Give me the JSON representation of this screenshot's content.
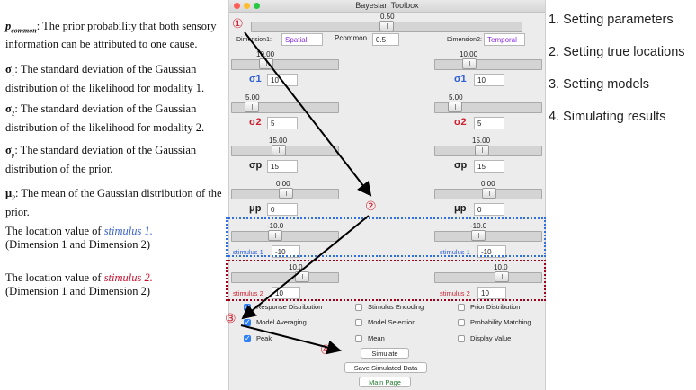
{
  "annotations": {
    "pcommon_sym": "p",
    "pcommon_sub": "common",
    "pcommon_text": ": The prior probability that both sensory information can be attributed to one cause.",
    "s1_sym": "σ",
    "s1_sub": "1",
    "s1_text": ": The standard deviation of the Gaussian distribution of the likelihood for modality 1.",
    "s2_sym": "σ",
    "s2_sub": "2",
    "s2_text": ": The standard deviation of the Gaussian distribution of the likelihood for modality 2.",
    "sp_sym": "σ",
    "sp_sub": "p",
    "sp_text": ": The standard deviation of the Gaussian distribution of the prior.",
    "mp_sym": "μ",
    "mp_sub": "P",
    "mp_text": ": The mean of the Gaussian distribution of the prior.",
    "stim1_pre": "The location value of ",
    "stim1_name": "stimulus 1.",
    "stim1_dims": "(Dimension 1 and Dimension 2)",
    "stim2_pre": "The location value of ",
    "stim2_name": "stimulus 2.",
    "stim2_dims": "(Dimension 1 and Dimension 2)"
  },
  "steps": [
    "1. Setting parameters",
    "2. Setting true locations",
    "3. Setting models",
    "4. Simulating results"
  ],
  "markers": {
    "m1": "①",
    "m2": "②",
    "m3": "③",
    "m4": "④"
  },
  "window": {
    "title": "Bayesian Toolbox",
    "pcommon_slider": 0.5,
    "pcommon_value": "0.50",
    "dimension1_label": "Dimension1:",
    "dimension1_value": "Spatial",
    "pcommon_label": "Pcommon",
    "pcommon_input": "0.5",
    "dimension2_label": "Dimension2:",
    "dimension2_value": "Temporal",
    "left": {
      "sigma1_value": "10.00",
      "sigma1_label": "σ1",
      "sigma1_input": "10",
      "sigma2_value": "5.00",
      "sigma2_label": "σ2",
      "sigma2_input": "5",
      "sigmap_value": "15.00",
      "sigmap_label": "σp",
      "sigmap_input": "15",
      "mup_value": "0.00",
      "mup_label": "μp",
      "mup_input": "0",
      "stim1_value": "-10.0",
      "stim1_label": "stimulus 1",
      "stim1_input": "-10",
      "stim2_value": "10.0",
      "stim2_label": "stimulus 2",
      "stim2_input": "10"
    },
    "right": {
      "sigma1_value": "10.00",
      "sigma1_label": "σ1",
      "sigma1_input": "10",
      "sigma2_value": "5.00",
      "sigma2_label": "σ2",
      "sigma2_input": "5",
      "sigmap_value": "15.00",
      "sigmap_label": "σp",
      "sigmap_input": "15",
      "mup_value": "0.00",
      "mup_label": "μp",
      "mup_input": "0",
      "stim1_value": "-10.0",
      "stim1_label": "stimulus 1",
      "stim1_input": "-10",
      "stim2_value": "10.0",
      "stim2_label": "stimulus 2",
      "stim2_input": "10"
    },
    "checkboxes": {
      "response_distribution": "Response Distribution",
      "stimulus_encoding": "Stimulus Encoding",
      "prior_distribution": "Prior Distribution",
      "model_averaging": "Model Averaging",
      "model_selection": "Model Selection",
      "probability_matching": "Probability Matching",
      "peak": "Peak",
      "mean": "Mean",
      "display_value": "Display Value"
    },
    "buttons": {
      "simulate": "Simulate",
      "save": "Save Simulated Data",
      "main": "Main Page"
    }
  },
  "colors": {
    "blue_accent": "#2f5fd6",
    "red_accent": "#d01f2f",
    "checkbox_blue": "#2f7ff7",
    "arrow": "#000000"
  }
}
